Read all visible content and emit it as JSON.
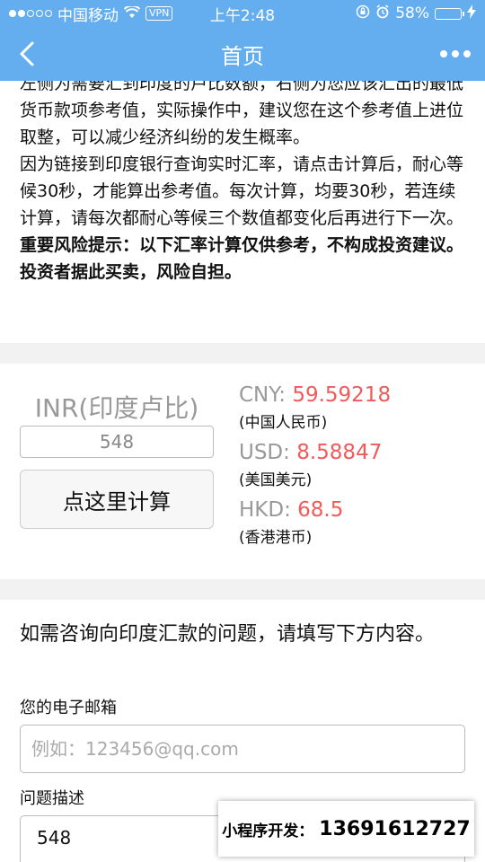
{
  "status_bar": {
    "carrier": "中国移动",
    "vpn": "VPN",
    "time": "上午2:48",
    "battery": "58%",
    "battery_level": 0.58
  },
  "nav": {
    "title": "首页",
    "back_icon": "chevron-left-icon",
    "more_icon": "more-dots-icon"
  },
  "intro": {
    "paragraph1": "左侧为需要汇到印度的卢比数额，右侧为您应该汇出的最低货币款项参考值，实际操作中，建议您在这个参考值上进位取整，可以减少经济纠纷的发生概率。",
    "paragraph2": "因为链接到印度银行查询实时汇率，请点击计算后，耐心等候30秒，才能算出参考值。每次计算，均要30秒，若连续计算，请每次都耐心等候三个数值都变化后再进行下一次。",
    "warning": "重要风险提示：以下汇率计算仅供参考，不构成投资建议。投资者据此买卖，风险自担。"
  },
  "calculator": {
    "inr_label": "INR(印度卢比)",
    "inr_value": "548",
    "button_label": "点这里计算",
    "rates": [
      {
        "code": "CNY: ",
        "value": "59.59218",
        "name": "(中国人民币)"
      },
      {
        "code": "USD: ",
        "value": "8.58847",
        "name": "(美国美元)"
      },
      {
        "code": "HKD: ",
        "value": "68.5",
        "name": "(香港港币)"
      }
    ]
  },
  "form": {
    "title": "如需咨询向印度汇款的问题，请填写下方内容。",
    "email_label": "您的电子邮箱",
    "email_placeholder": "例如：123456@qq.com",
    "desc_label": "问题描述",
    "desc_value": "548"
  },
  "promo": {
    "label": "小程序开发：",
    "phone": "13691612727"
  },
  "colors": {
    "accent": "#64aef0",
    "rate_value": "#f05a5a"
  }
}
